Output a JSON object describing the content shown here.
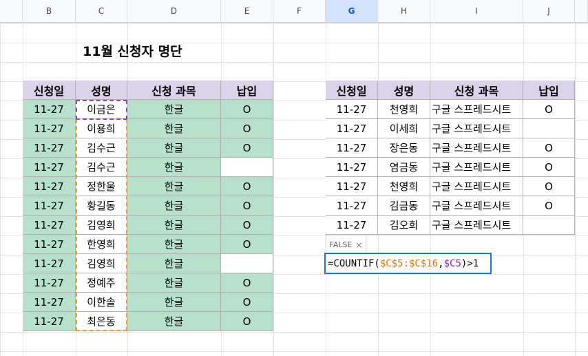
{
  "columns": [
    "B",
    "C",
    "D",
    "E",
    "F",
    "G",
    "H",
    "I",
    "J"
  ],
  "selected_column": "G",
  "title": "11월 신청자 명단",
  "table1": {
    "headers": [
      "신청일",
      "성명",
      "신청 과목",
      "납입"
    ],
    "rows": [
      [
        "11-27",
        "이금은",
        "한글",
        "O"
      ],
      [
        "11-27",
        "이용희",
        "한글",
        "O"
      ],
      [
        "11-27",
        "김수근",
        "한글",
        "O"
      ],
      [
        "11-27",
        "김수근",
        "한글",
        ""
      ],
      [
        "11-27",
        "정한울",
        "한글",
        "O"
      ],
      [
        "11-27",
        "황길동",
        "한글",
        "O"
      ],
      [
        "11-27",
        "김영희",
        "한글",
        "O"
      ],
      [
        "11-27",
        "한영희",
        "한글",
        "O"
      ],
      [
        "11-27",
        "김영희",
        "한글",
        ""
      ],
      [
        "11-27",
        "정예주",
        "한글",
        "O"
      ],
      [
        "11-27",
        "이한솔",
        "한글",
        "O"
      ],
      [
        "11-27",
        "최은동",
        "한글",
        "O"
      ]
    ]
  },
  "table2": {
    "headers": [
      "신청일",
      "성명",
      "신청 과목",
      "납입"
    ],
    "rows": [
      [
        "11-27",
        "천영희",
        "구글 스프레드시트",
        "O"
      ],
      [
        "11-27",
        "이세희",
        "구글 스프레드시트",
        ""
      ],
      [
        "11-27",
        "장은동",
        "구글 스프레드시트",
        "O"
      ],
      [
        "11-27",
        "염금동",
        "구글 스프레드시트",
        "O"
      ],
      [
        "11-27",
        "천영희",
        "구글 스프레드시트",
        "O"
      ],
      [
        "11-27",
        "김금동",
        "구글 스프레드시트",
        "O"
      ],
      [
        "11-27",
        "김오희",
        "구글 스프레드시트",
        ""
      ]
    ]
  },
  "tooltip": {
    "value": "FALSE",
    "close": "×"
  },
  "formula": {
    "prefix": "=COUNTIF(",
    "range": "$C$5:$C$16",
    "sep": ",",
    "ref": "$C5",
    "suffix": ")>1"
  }
}
